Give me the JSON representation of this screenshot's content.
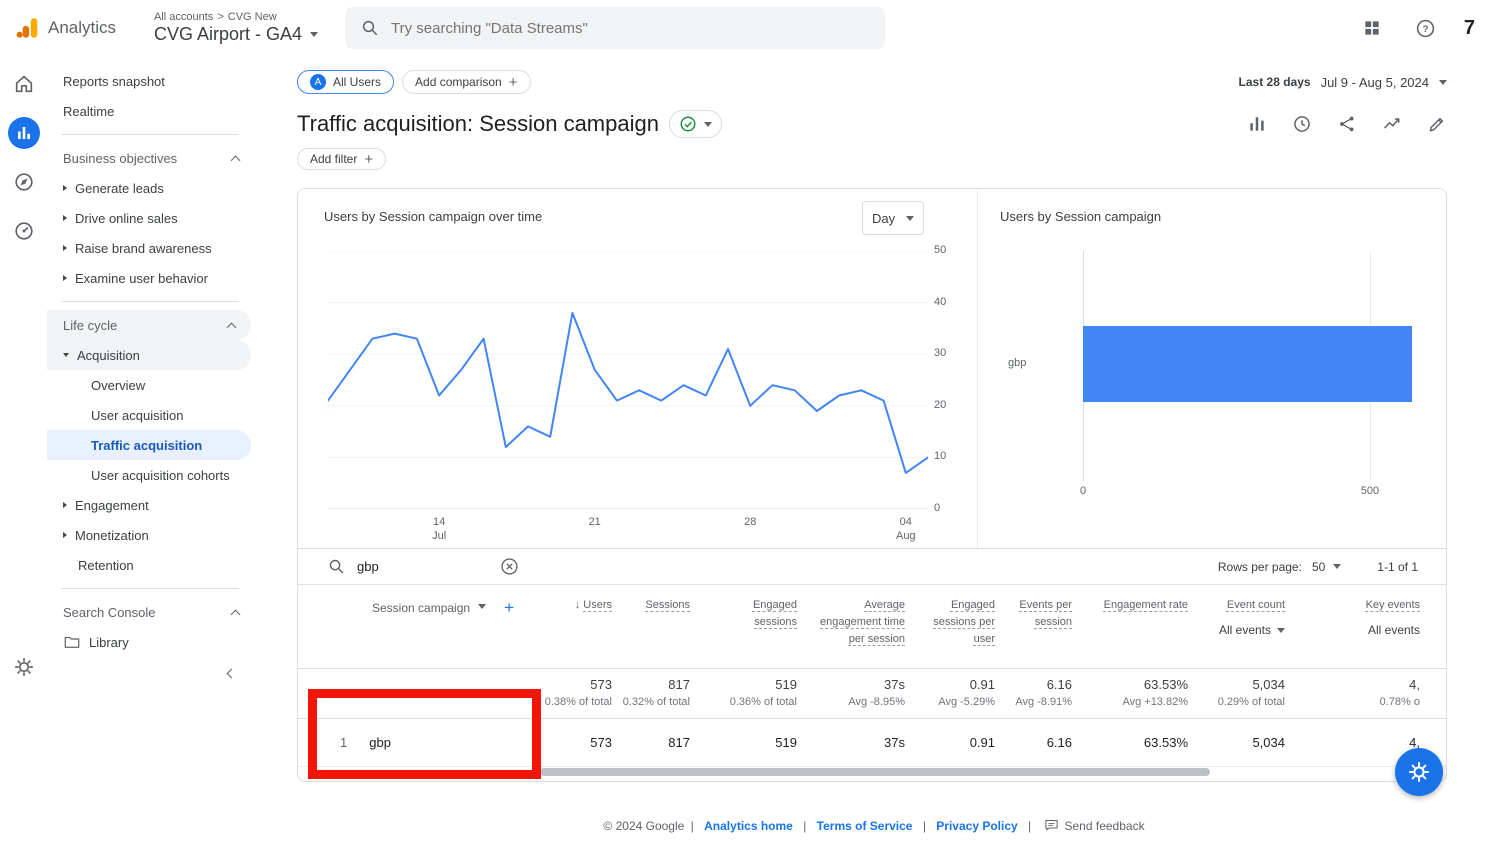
{
  "header": {
    "app_name": "Analytics",
    "breadcrumb": {
      "root": "All accounts",
      "sep": ">",
      "current": "CVG New"
    },
    "property_selector": "CVG Airport - GA4",
    "search_placeholder": "Try searching \"Data Streams\"",
    "icons": [
      "apps-grid",
      "help"
    ],
    "profile_label": "7"
  },
  "rail": {
    "icons": [
      "home",
      "reports",
      "explore",
      "advertising"
    ],
    "selected": "reports",
    "bottom_icon": "settings"
  },
  "nav": {
    "top_items": [
      "Reports snapshot",
      "Realtime"
    ],
    "business_objectives": {
      "title": "Business objectives",
      "items": [
        "Generate leads",
        "Drive online sales",
        "Raise brand awareness",
        "Examine user behavior"
      ]
    },
    "life_cycle": {
      "title": "Life cycle",
      "acquisition": {
        "label": "Acquisition",
        "children": [
          "Overview",
          "User acquisition",
          "Traffic acquisition",
          "User acquisition cohorts"
        ],
        "selected_child": "Traffic acquisition"
      },
      "items": [
        "Engagement",
        "Monetization",
        "Retention"
      ]
    },
    "search_console": {
      "title": "Search Console"
    },
    "library": "Library"
  },
  "toolbar": {
    "all_users_badge": "A",
    "all_users_chip": "All Users",
    "add_comparison": "Add comparison",
    "date_range": {
      "label": "Last 28 days",
      "value": "Jul 9 - Aug 5, 2024"
    }
  },
  "page": {
    "title": "Traffic acquisition: Session campaign",
    "add_filter": "Add filter"
  },
  "charts": {
    "line_title": "Users by Session campaign over time",
    "granularity": "Day",
    "bar_title": "Users by Session campaign"
  },
  "chart_data": [
    {
      "type": "line",
      "title": "Users by Session campaign over time",
      "x": [
        "Jul 9",
        "Jul 10",
        "Jul 11",
        "Jul 12",
        "Jul 13",
        "Jul 14",
        "Jul 15",
        "Jul 16",
        "Jul 17",
        "Jul 18",
        "Jul 19",
        "Jul 20",
        "Jul 21",
        "Jul 22",
        "Jul 23",
        "Jul 24",
        "Jul 25",
        "Jul 26",
        "Jul 27",
        "Jul 28",
        "Jul 29",
        "Jul 30",
        "Jul 31",
        "Aug 1",
        "Aug 2",
        "Aug 3",
        "Aug 4",
        "Aug 5"
      ],
      "values": [
        21,
        27,
        33,
        34,
        33,
        22,
        27,
        33,
        12,
        16,
        14,
        38,
        27,
        21,
        23,
        21,
        24,
        22,
        31,
        20,
        24,
        23,
        19,
        22,
        23,
        21,
        7,
        10
      ],
      "ylim": [
        0,
        50
      ],
      "y_ticks": [
        0,
        10,
        20,
        30,
        40,
        50
      ],
      "x_ticks": [
        "14\nJul",
        "21",
        "28",
        "04\nAug"
      ],
      "x_tick_idx": [
        5,
        12,
        19,
        26
      ],
      "color": "#4285f4",
      "legend": "none",
      "grid": "light-horizontal"
    },
    {
      "type": "bar",
      "orientation": "horizontal",
      "title": "Users by Session campaign",
      "categories": [
        "gbp"
      ],
      "values": [
        573
      ],
      "xlim": [
        0,
        575
      ],
      "x_ticks": [
        0,
        500
      ],
      "color": "#4285f4"
    }
  ],
  "table": {
    "search_value": "gbp",
    "rows_per_page_label": "Rows per page:",
    "rows_per_page_value": "50",
    "pagination": "1-1 of 1",
    "dimension_header": "Session campaign",
    "columns": [
      {
        "label": "Users",
        "sorted": "desc"
      },
      {
        "label": "Sessions"
      },
      {
        "label": "Engaged sessions"
      },
      {
        "label": "Average engagement time per session"
      },
      {
        "label": "Engaged sessions per user"
      },
      {
        "label": "Events per session"
      },
      {
        "label": "Engagement rate"
      },
      {
        "label": "Event count",
        "filter": "All events"
      },
      {
        "label": "Key events",
        "filter": "All events"
      }
    ],
    "totals": {
      "values": [
        "573",
        "817",
        "519",
        "37s",
        "0.91",
        "6.16",
        "63.53%",
        "5,034",
        "4,"
      ],
      "subs": [
        "0.38% of total",
        "0.32% of total",
        "0.36% of total",
        "Avg -8.95%",
        "Avg -5.29%",
        "Avg -8.91%",
        "Avg +13.82%",
        "0.29% of total",
        "0.78% o"
      ]
    },
    "rows": [
      {
        "index": "1",
        "campaign": "gbp",
        "values": [
          "573",
          "817",
          "519",
          "37s",
          "0.91",
          "6.16",
          "63.53%",
          "5,034",
          "4,"
        ]
      }
    ]
  },
  "footer": {
    "copyright": "© 2024 Google",
    "separator": "|",
    "links": [
      "Analytics home",
      "Terms of Service",
      "Privacy Policy"
    ],
    "send_feedback": "Send feedback"
  },
  "colors": {
    "accent": "#1a73e8",
    "series_blue": "#4285f4",
    "nav_selected_bg": "#e8f0fe",
    "green_check": "#1e8e3e",
    "annotation_red": "#f31505"
  }
}
